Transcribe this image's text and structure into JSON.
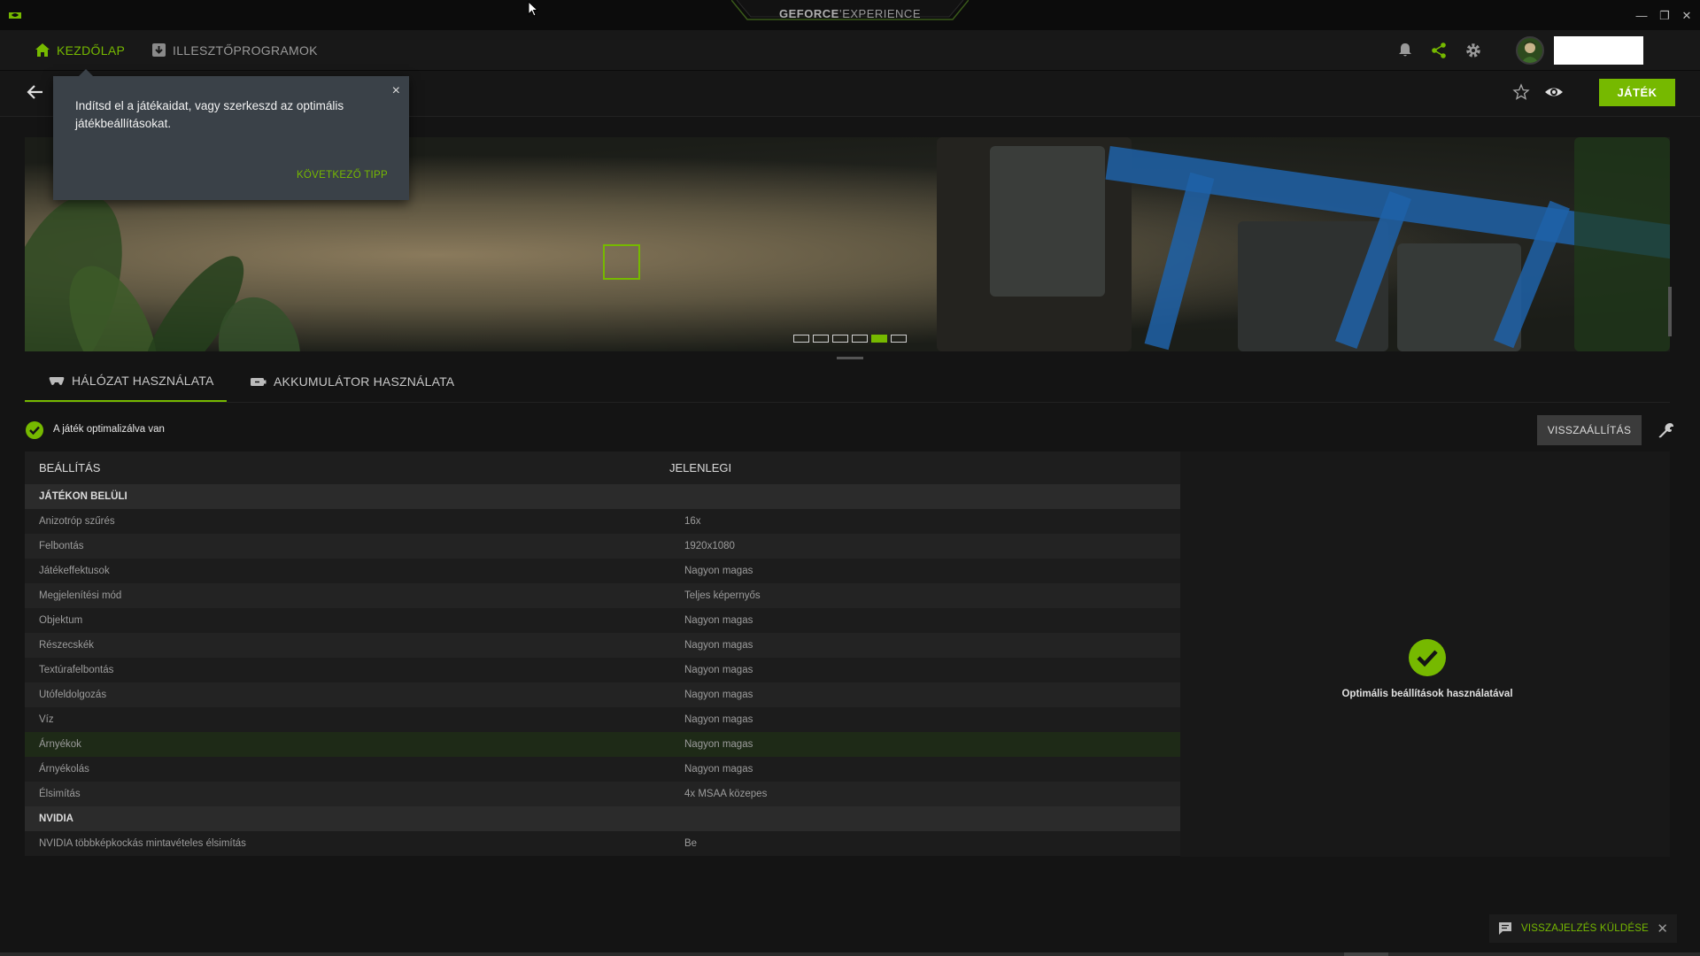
{
  "titlebar": {
    "brand_bold": "GEFORCE",
    "brand_light": "EXPERIENCE",
    "minimize": "—",
    "restore": "❐",
    "close": "✕"
  },
  "nav": {
    "home_label": "KEZDŐLAP",
    "drivers_label": "ILLESZTŐPROGRAMOK",
    "icons": [
      "bell-icon",
      "share-icon",
      "gear-icon"
    ],
    "accent_color": "#76b900"
  },
  "game_header": {
    "play_label": "JÁTÉK"
  },
  "tooltip": {
    "text": "Indítsd el a játékaidat, vagy szerkeszd az optimális játékbeállításokat.",
    "next_label": "KÖVETKEZŐ TIPP",
    "close": "×"
  },
  "carousel": {
    "count": 6,
    "active_index": 4
  },
  "tabs": {
    "network_label": "HÁLÓZAT HASZNÁLATA",
    "battery_label": "AKKUMULÁTOR HASZNÁLATA"
  },
  "status": {
    "optimized_label": "A játék optimalizálva van",
    "reset_label": "VISSZAÁLLÍTÁS"
  },
  "table": {
    "col_setting": "BEÁLLÍTÁS",
    "col_current": "JELENLEGI",
    "section_ingame": "JÁTÉKON BELÜLI",
    "ingame_rows": [
      {
        "setting": "Anizotróp szűrés",
        "current": "16x"
      },
      {
        "setting": "Felbontás",
        "current": "1920x1080"
      },
      {
        "setting": "Játékeffektusok",
        "current": "Nagyon magas"
      },
      {
        "setting": "Megjelenítési mód",
        "current": "Teljes képernyős"
      },
      {
        "setting": "Objektum",
        "current": "Nagyon magas"
      },
      {
        "setting": "Részecskék",
        "current": "Nagyon magas"
      },
      {
        "setting": "Textúrafelbontás",
        "current": "Nagyon magas"
      },
      {
        "setting": "Utófeldolgozás",
        "current": "Nagyon magas"
      },
      {
        "setting": "Víz",
        "current": "Nagyon magas"
      },
      {
        "setting": "Árnyékok",
        "current": "Nagyon magas"
      },
      {
        "setting": "Árnyékolás",
        "current": "Nagyon magas"
      },
      {
        "setting": "Élsimítás",
        "current": "4x MSAA közepes"
      }
    ],
    "section_nvidia": "NVIDIA",
    "nvidia_rows": [
      {
        "setting": "NVIDIA többképkockás mintavételes élsimítás",
        "current": "Be"
      }
    ]
  },
  "right_panel": {
    "optimal_label": "Optimális beállítások használatával"
  },
  "feedback": {
    "label": "VISSZAJELZÉS KÜLDÉSE",
    "close": "✕"
  }
}
